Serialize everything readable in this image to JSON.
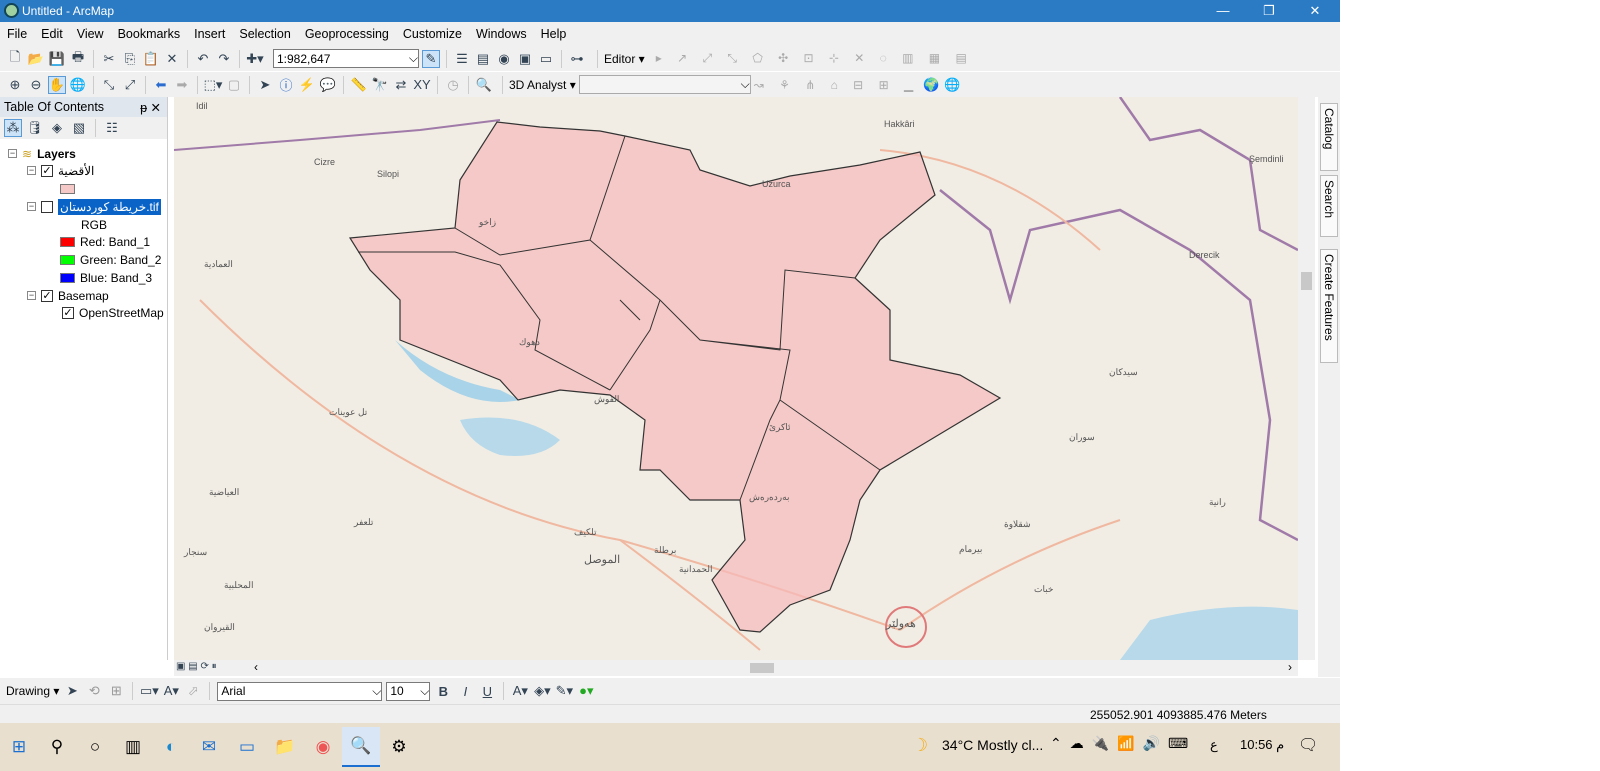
{
  "window": {
    "title": "Untitled - ArcMap",
    "minimize": "—",
    "maximize": "❐",
    "close": "✕"
  },
  "menu": [
    "File",
    "Edit",
    "View",
    "Bookmarks",
    "Insert",
    "Selection",
    "Geoprocessing",
    "Customize",
    "Windows",
    "Help"
  ],
  "toolbar": {
    "scale": "1:982,647",
    "editor": "Editor ▾",
    "analyst": "3D Analyst ▾"
  },
  "toc": {
    "title": "Table Of Contents",
    "layers_root": "Layers",
    "layer1": "الأقضية",
    "layer2": ".خريطة كوردستان.tif",
    "layer2_display": "خريطة كوردستان.tif",
    "rgb": "RGB",
    "red": "Red:   Band_1",
    "green": "Green: Band_2",
    "blue": "Blue:   Band_3",
    "basemap": "Basemap",
    "osm": "OpenStreetMap",
    "colors": {
      "polygon": "#f6c9c9",
      "red": "#ff0000",
      "green": "#00ff00",
      "blue": "#0000ff"
    }
  },
  "map_labels": [
    "Hakkâri",
    "Şemdinli",
    "Cizre",
    "Silopi",
    "Derecik",
    "Uzurca",
    "Idil",
    "الموصل",
    "هەولێر",
    "دهوك",
    "زاخو",
    "العمادية",
    "سوران",
    "شقلاوة",
    "تل عوينات",
    "تلعفر",
    "المحلبية",
    "سنجار",
    "العياضية",
    "القيروان",
    "ئاكرێ",
    "بەردەرەش",
    "الحمدانية",
    "برطلة",
    "تلكيف",
    "القوش",
    "رانية",
    "سيدكان",
    "بيرمام",
    "خبات"
  ],
  "dock": [
    "Catalog",
    "Search",
    "Create Features"
  ],
  "drawing": {
    "label": "Drawing ▾",
    "font": "Arial",
    "size": "10"
  },
  "status": {
    "coords": "255052.901  4093885.476 Meters"
  },
  "taskbar": {
    "weather": "34°C  Mostly cl...",
    "lang": "ع",
    "time": "10:56 م"
  }
}
